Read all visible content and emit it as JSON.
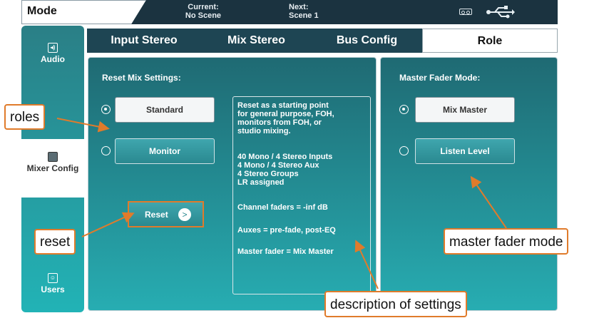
{
  "topbar": {
    "mode_label": "Mode",
    "current_label": "Current:",
    "current_value": "No Scene",
    "next_label": "Next:",
    "next_value": "Scene 1",
    "usb_icon": "usb-icon",
    "tape_icon": "tape-icon"
  },
  "nav": {
    "items": [
      {
        "label": "Audio",
        "icon": "speaker-icon"
      },
      {
        "label": "Mixer Config",
        "icon": "mixer-icon"
      },
      {
        "label": "Users",
        "icon": "users-icon"
      }
    ],
    "active": "Mixer Config"
  },
  "tabs": [
    {
      "label": "Input Stereo"
    },
    {
      "label": "Mix Stereo"
    },
    {
      "label": "Bus Config"
    },
    {
      "label": "Role"
    }
  ],
  "reset_panel": {
    "title": "Reset Mix Settings:",
    "options": [
      {
        "label": "Standard",
        "selected": true
      },
      {
        "label": "Monitor",
        "selected": false
      }
    ],
    "reset_label": "Reset",
    "description_lines": [
      "Reset as a starting point",
      "for general purpose, FOH,",
      "monitors from FOH, or",
      "studio mixing.",
      "40 Mono / 4 Stereo Inputs",
      "4 Mono / 4 Stereo Aux",
      "4 Stereo Groups",
      "LR assigned",
      "Channel faders = -inf dB",
      "Auxes = pre-fade, post-EQ",
      "Master fader = Mix Master"
    ]
  },
  "master_panel": {
    "title": "Master Fader Mode:",
    "options": [
      {
        "label": "Mix Master",
        "selected": true
      },
      {
        "label": "Listen Level",
        "selected": false
      }
    ]
  },
  "callouts": {
    "roles": "roles",
    "reset": "reset",
    "master_fader_mode": "master fader mode",
    "description_of_settings": "description of settings"
  },
  "colors": {
    "callout_border": "#e07b2b",
    "panel_top": "#1f6a73",
    "panel_bottom": "#27adb2",
    "topbar": "#1b3340"
  }
}
